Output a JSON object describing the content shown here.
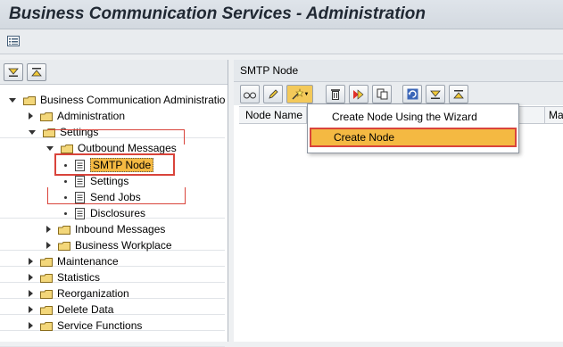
{
  "window": {
    "title": "Business Communication Services - Administration"
  },
  "tree": {
    "items": [
      {
        "label": "Business Communication Administratio",
        "level": 0,
        "expanded": true
      },
      {
        "label": "Administration",
        "level": 1
      },
      {
        "label": "Settings",
        "level": 1,
        "expanded": true
      },
      {
        "label": "Outbound Messages",
        "level": 2,
        "expanded": true
      },
      {
        "label": "SMTP Node",
        "level": 3,
        "selected": true
      },
      {
        "label": "Settings",
        "level": 3
      },
      {
        "label": "Send Jobs",
        "level": 3
      },
      {
        "label": "Disclosures",
        "level": 3
      },
      {
        "label": "Inbound Messages",
        "level": 2
      },
      {
        "label": "Business Workplace",
        "level": 2
      },
      {
        "label": "Maintenance",
        "level": 1
      },
      {
        "label": "Statistics",
        "level": 1
      },
      {
        "label": "Reorganization",
        "level": 1
      },
      {
        "label": "Delete Data",
        "level": 1
      },
      {
        "label": "Service Functions",
        "level": 1
      }
    ]
  },
  "right": {
    "panel_title": "SMTP Node",
    "columns": [
      "Node Name",
      "Ma"
    ]
  },
  "context_menu": {
    "items": [
      "Create Node Using the Wizard",
      "Create Node"
    ],
    "highlighted": 1
  },
  "colors": {
    "highlight": "#f4b942",
    "callout": "#d9443b",
    "folder": "#f3d77a"
  }
}
